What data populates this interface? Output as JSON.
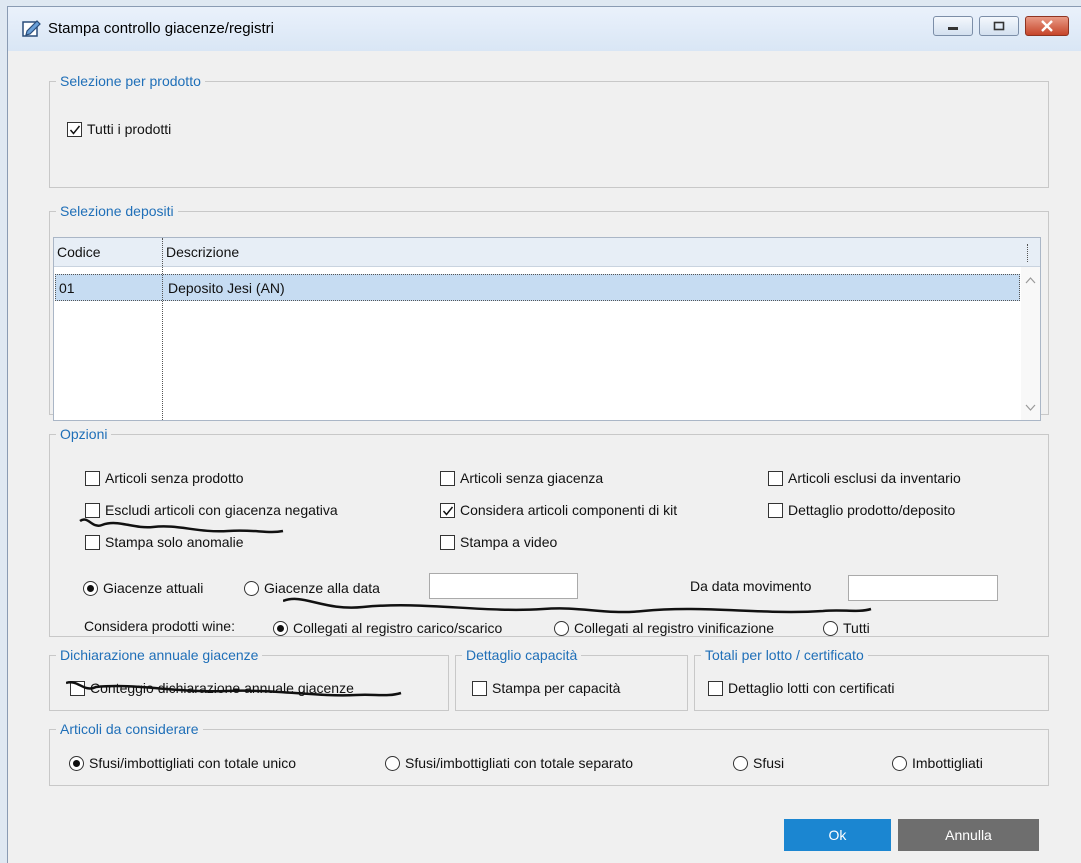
{
  "window": {
    "title": "Stampa controllo giacenze/registri",
    "app_icon": "print-edit-icon"
  },
  "selezione_prodotto": {
    "legend": "Selezione per prodotto",
    "tutti_label": "Tutti i prodotti",
    "tutti_checked": true
  },
  "depositi": {
    "legend": "Selezione depositi",
    "columns": [
      "Codice",
      "Descrizione"
    ],
    "rows": [
      {
        "codice": "01",
        "descrizione": "Deposito Jesi (AN)"
      }
    ]
  },
  "opzioni": {
    "legend": "Opzioni",
    "checkboxes": [
      {
        "label": "Articoli senza prodotto",
        "checked": false
      },
      {
        "label": "Articoli senza giacenza",
        "checked": false
      },
      {
        "label": "Articoli esclusi da inventario",
        "checked": false
      },
      {
        "label": "Escludi articoli con giacenza negativa",
        "checked": false
      },
      {
        "label": "Considera articoli componenti di kit",
        "checked": true
      },
      {
        "label": "Dettaglio prodotto/deposito",
        "checked": false
      },
      {
        "label": "Stampa solo anomalie",
        "checked": false
      },
      {
        "label": "Stampa a video",
        "checked": false
      }
    ],
    "giacenze_radios": [
      {
        "label": "Giacenze attuali",
        "selected": true
      },
      {
        "label": "Giacenze alla data",
        "selected": false
      }
    ],
    "giacenze_data_value": "",
    "da_data_label": "Da data movimento",
    "da_data_value": "",
    "wine_label": "Considera prodotti wine:",
    "wine_radios": [
      {
        "label": "Collegati al registro carico/scarico",
        "selected": true
      },
      {
        "label": "Collegati al registro vinificazione",
        "selected": false
      },
      {
        "label": "Tutti",
        "selected": false
      }
    ]
  },
  "dichiarazione": {
    "legend": "Dichiarazione annuale giacenze",
    "checkbox_label": "Conteggio dichiarazione annuale giacenze",
    "checked": false
  },
  "capacita": {
    "legend": "Dettaglio capacità",
    "checkbox_label": "Stampa per capacità",
    "checked": false
  },
  "lotti": {
    "legend": "Totali per lotto / certificato",
    "checkbox_label": "Dettaglio lotti con certificati",
    "checked": false
  },
  "articoli": {
    "legend": "Articoli da considerare",
    "radios": [
      {
        "label": "Sfusi/imbottigliati con totale unico",
        "selected": true
      },
      {
        "label": "Sfusi/imbottigliati con totale separato",
        "selected": false
      },
      {
        "label": "Sfusi",
        "selected": false
      },
      {
        "label": "Imbottigliati",
        "selected": false
      }
    ]
  },
  "buttons": {
    "ok": "Ok",
    "cancel": "Annulla"
  },
  "colors": {
    "legend_blue": "#1f6fb8",
    "ok_blue": "#1b86d1",
    "cancel_gray": "#6e6e6e",
    "row_selected": "#c6dcf2"
  }
}
